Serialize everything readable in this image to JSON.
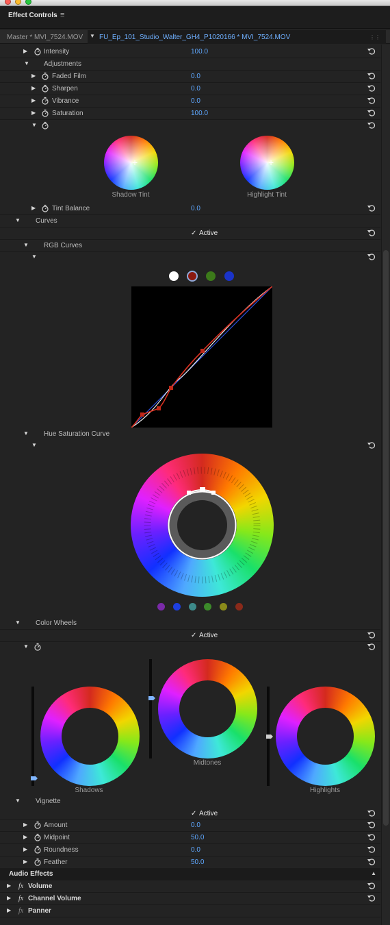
{
  "window": {
    "traffic_lights": [
      "#ff5f57",
      "#febc2e",
      "#28c840"
    ]
  },
  "panel": {
    "title": "Effect Controls",
    "menu_icon": "hamburger-menu-icon"
  },
  "clip": {
    "master": "Master * MVI_7524.MOV",
    "sequence": "FU_Ep_101_Studio_Walter_GH4_P1020166 * MVI_7524.MOV"
  },
  "intensity": {
    "label": "Intensity",
    "value": "100.0"
  },
  "adjustments": {
    "label": "Adjustments",
    "items": [
      {
        "label": "Faded Film",
        "value": "0.0"
      },
      {
        "label": "Sharpen",
        "value": "0.0"
      },
      {
        "label": "Vibrance",
        "value": "0.0"
      },
      {
        "label": "Saturation",
        "value": "100.0"
      }
    ]
  },
  "tint": {
    "shadow_label": "Shadow Tint",
    "highlight_label": "Highlight Tint"
  },
  "tint_balance": {
    "label": "Tint Balance",
    "value": "0.0"
  },
  "curves": {
    "label": "Curves",
    "active_label": "Active",
    "rgb_label": "RGB Curves",
    "channel_colors": [
      "#ffffff",
      "#8b1a10",
      "#3c7a1a",
      "#1a33c8"
    ],
    "hue_sat_label": "Hue Saturation Curve",
    "hue_sat_colors": [
      "#7a2aa8",
      "#1d3fe0",
      "#3d8a8a",
      "#3c8a2a",
      "#8a8a1a",
      "#8a2a1a"
    ]
  },
  "color_wheels": {
    "label": "Color Wheels",
    "active_label": "Active",
    "shadows_label": "Shadows",
    "midtones_label": "Midtones",
    "highlights_label": "Highlights"
  },
  "vignette": {
    "label": "Vignette",
    "active_label": "Active",
    "items": [
      {
        "label": "Amount",
        "value": "0.0"
      },
      {
        "label": "Midpoint",
        "value": "50.0"
      },
      {
        "label": "Roundness",
        "value": "0.0"
      },
      {
        "label": "Feather",
        "value": "50.0"
      }
    ]
  },
  "audio": {
    "header": "Audio Effects",
    "items": [
      {
        "label": "Volume"
      },
      {
        "label": "Channel Volume"
      },
      {
        "label": "Panner"
      }
    ],
    "fx_glyph": "fx"
  },
  "glyphs": {
    "check": "✓",
    "tri_open": "▼",
    "tri_closed": "▶",
    "cross": "+"
  }
}
